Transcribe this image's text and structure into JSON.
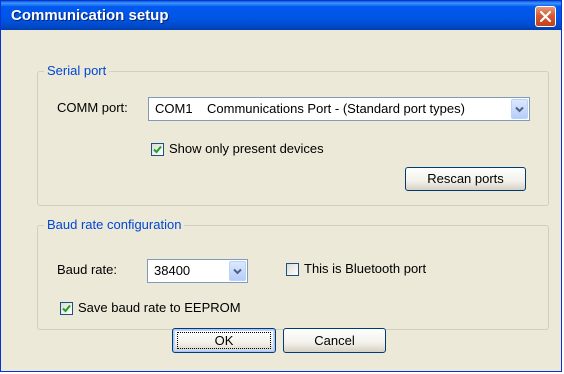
{
  "window": {
    "title": "Communication setup"
  },
  "serial_port": {
    "group_label": "Serial port",
    "comm_port_label": "COMM port:",
    "comm_port_value": "COM1    Communications Port - (Standard port types)",
    "show_present_label": "Show only present devices",
    "show_present_checked": true,
    "rescan_label": "Rescan ports"
  },
  "baud": {
    "group_label": "Baud rate configuration",
    "baud_rate_label": "Baud rate:",
    "baud_rate_value": "38400",
    "bluetooth_label": "This is Bluetooth port",
    "bluetooth_checked": false,
    "save_eeprom_label": "Save baud rate to EEPROM",
    "save_eeprom_checked": true
  },
  "buttons": {
    "ok": "OK",
    "cancel": "Cancel"
  },
  "icons": {
    "close": "close-icon",
    "dropdown": "chevron-down-icon",
    "check": "checkmark-icon"
  },
  "colors": {
    "titlebar": "#0058ee",
    "group_label": "#0046d5",
    "dialog_bg": "#ece9d8",
    "close_button": "#d55a33",
    "checkmark": "#21a121"
  }
}
